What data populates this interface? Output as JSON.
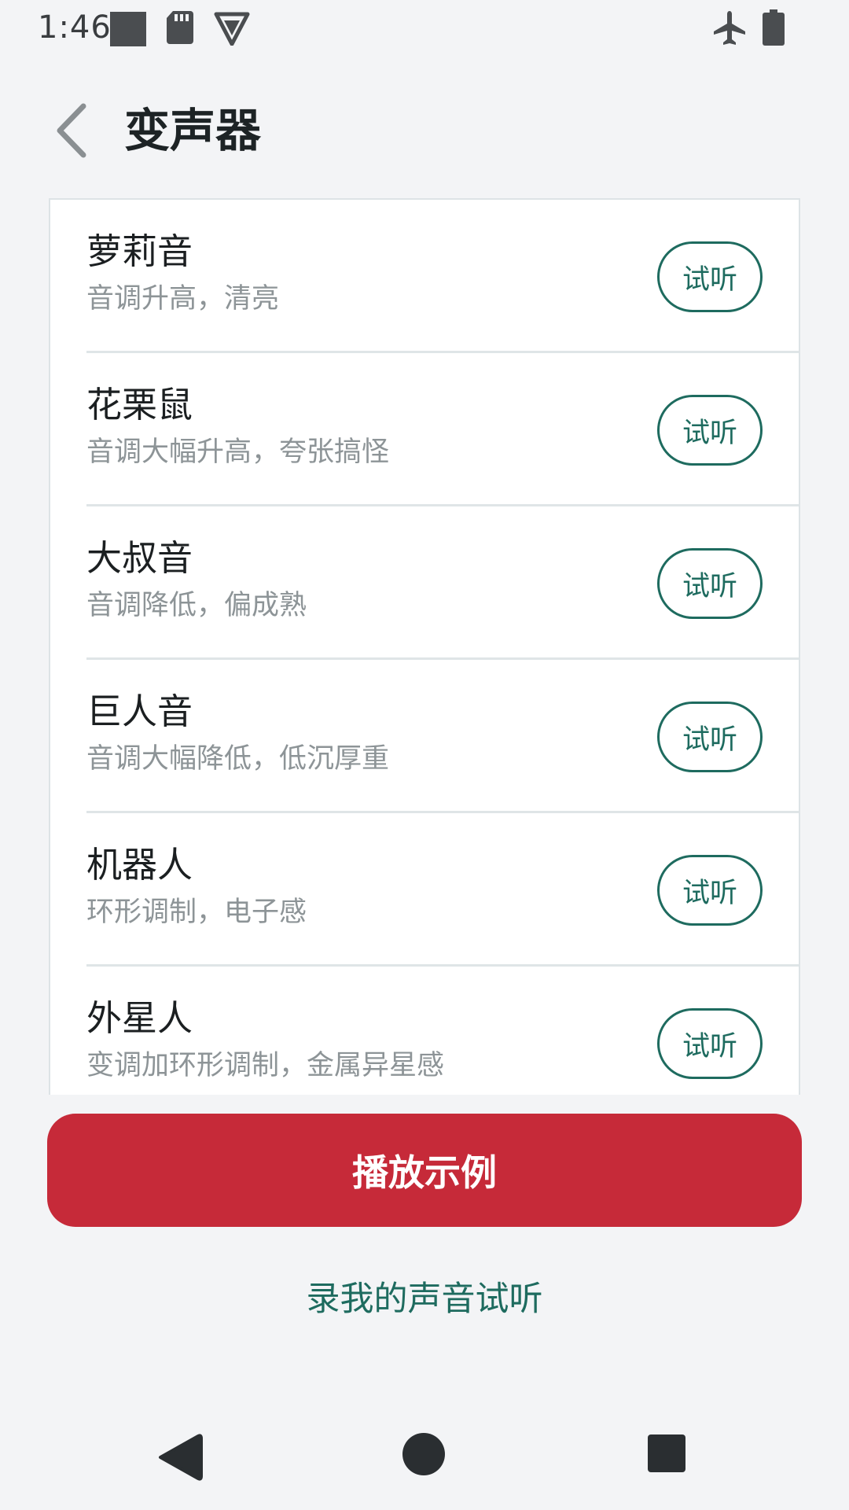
{
  "status_bar": {
    "time": "1:46"
  },
  "header": {
    "title": "变声器"
  },
  "voices": [
    {
      "name": "萝莉音",
      "desc": "音调升高，清亮",
      "button": "试听"
    },
    {
      "name": "花栗鼠",
      "desc": "音调大幅升高，夸张搞怪",
      "button": "试听"
    },
    {
      "name": "大叔音",
      "desc": "音调降低，偏成熟",
      "button": "试听"
    },
    {
      "name": "巨人音",
      "desc": "音调大幅降低，低沉厚重",
      "button": "试听"
    },
    {
      "name": "机器人",
      "desc": "环形调制，电子感",
      "button": "试听"
    },
    {
      "name": "外星人",
      "desc": "变调加环形调制，金属异星感",
      "button": "试听"
    }
  ],
  "actions": {
    "play_example": "播放示例",
    "record_try": "录我的声音试听"
  },
  "colors": {
    "accent_green": "#1e6b5f",
    "primary_red": "#c62a39",
    "background": "#f3f4f6"
  }
}
